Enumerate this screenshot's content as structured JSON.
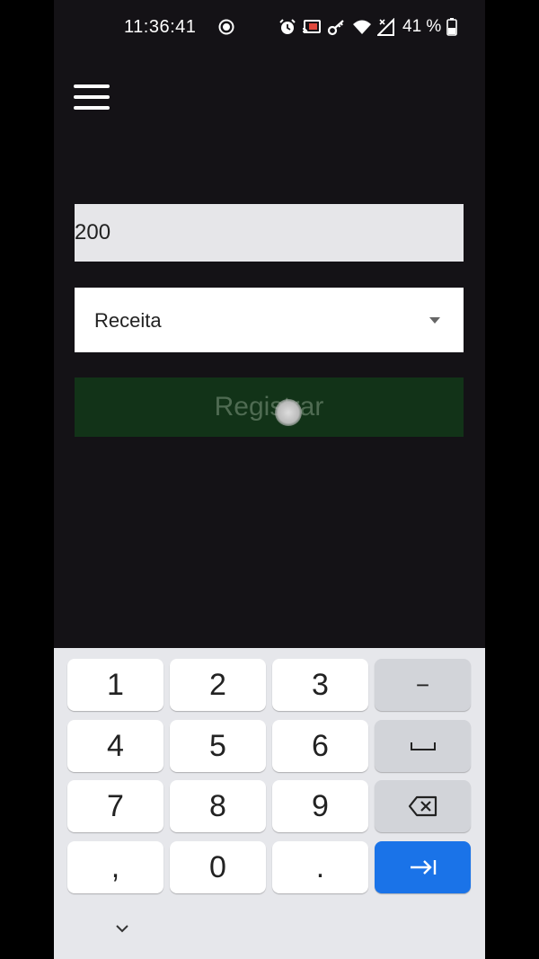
{
  "status_bar": {
    "time": "11:36:41",
    "battery_percent": "41 %",
    "icons": [
      "record-icon",
      "alarm-icon",
      "cast-icon",
      "vpn-key-icon",
      "wifi-icon",
      "signal-icon",
      "battery-icon"
    ]
  },
  "form": {
    "amount_value": "200",
    "type_selected": "Receita",
    "register_label": "Registrar"
  },
  "keyboard": {
    "rows": [
      [
        "1",
        "2",
        "3",
        "−"
      ],
      [
        "4",
        "5",
        "6",
        "␣"
      ],
      [
        "7",
        "8",
        "9",
        "⌫"
      ],
      [
        ",",
        "0",
        ".",
        "⇥"
      ]
    ]
  },
  "colors": {
    "background": "#141216",
    "register_button": "#123318",
    "enter_key": "#1a73e8"
  }
}
